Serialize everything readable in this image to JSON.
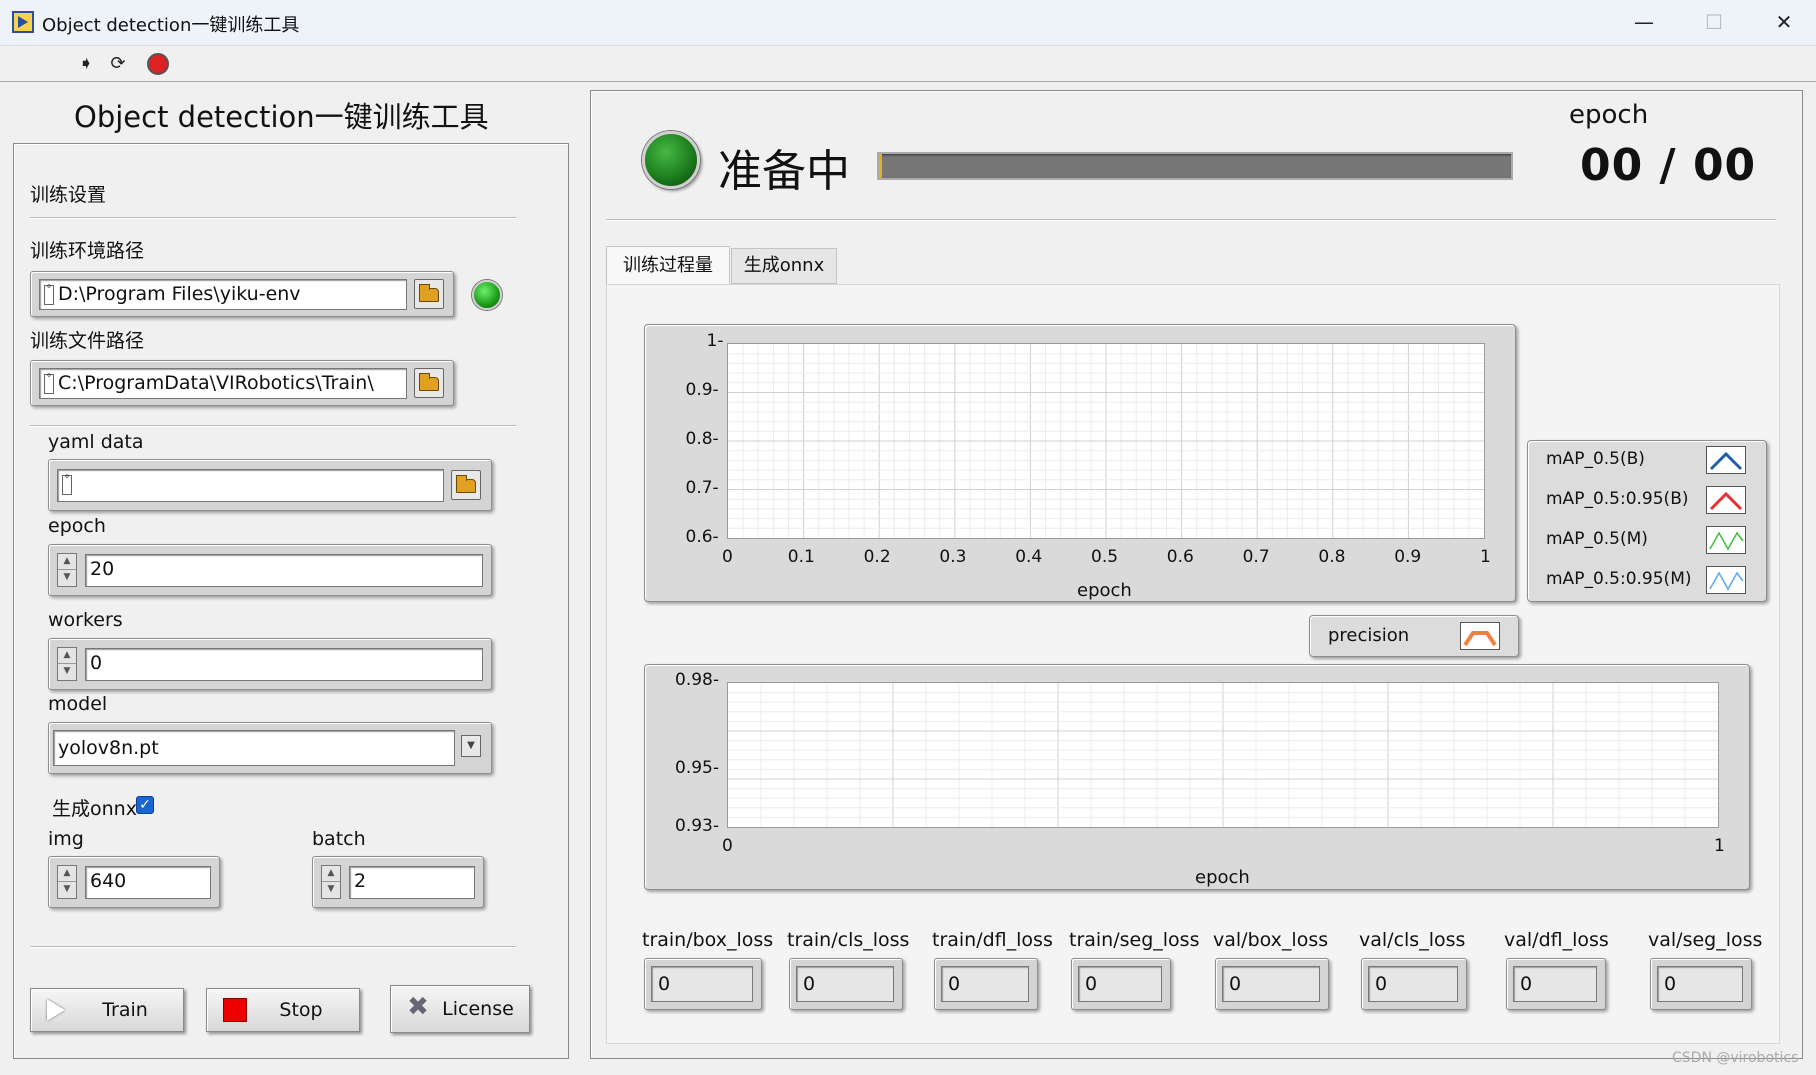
{
  "window": {
    "title": "Object detection一键训练工具",
    "minimize": "—",
    "maximize": "☐",
    "close": "✕"
  },
  "toolbar": {
    "run_icon": "run-arrow-icon",
    "run_continuous_icon": "run-continuously-icon",
    "abort_icon": "abort-icon"
  },
  "heading": "Object detection一键训练工具",
  "settings": {
    "section_title": "训练设置",
    "env_path": {
      "label": "训练环境路径",
      "value": "D:\\Program Files\\yiku-env",
      "status_color": "#22aa22"
    },
    "file_path": {
      "label": "训练文件路径",
      "value": "C:\\ProgramData\\VIRobotics\\Train\\"
    },
    "yaml": {
      "label": "yaml data",
      "value": ""
    },
    "epoch": {
      "label": "epoch",
      "value": "20"
    },
    "workers": {
      "label": "workers",
      "value": "0"
    },
    "model": {
      "label": "model",
      "value": "yolov8n.pt"
    },
    "onnx": {
      "label": "生成onnx",
      "checked": true
    },
    "img": {
      "label": "img",
      "value": "640"
    },
    "batch": {
      "label": "batch",
      "value": "2"
    }
  },
  "buttons": {
    "train": "Train",
    "stop": "Stop",
    "license": "License"
  },
  "status": {
    "text": "准备中",
    "led_color": "#1d7f1d",
    "progress": 0.0,
    "epoch_label": "epoch",
    "epoch_value": "00 / 00"
  },
  "tabs": [
    {
      "label": "训练过程量",
      "active": true
    },
    {
      "label": "生成onnx",
      "active": false
    }
  ],
  "chart_data": [
    {
      "type": "line",
      "xlabel": "epoch",
      "xlim": [
        0,
        1
      ],
      "ylim": [
        0.6,
        1
      ],
      "x_ticks": [
        "0",
        "0.1",
        "0.2",
        "0.3",
        "0.4",
        "0.5",
        "0.6",
        "0.7",
        "0.8",
        "0.9",
        "1"
      ],
      "y_ticks": [
        "1",
        "0.9",
        "0.8",
        "0.7",
        "0.6"
      ],
      "grid": true,
      "legend_position": "right",
      "series": [
        {
          "name": "mAP_0.5(B)",
          "color": "#1f5fa8",
          "values": []
        },
        {
          "name": "mAP_0.5:0.95(B)",
          "color": "#e83030",
          "values": []
        },
        {
          "name": "mAP_0.5(M)",
          "color": "#3cc03c",
          "values": []
        },
        {
          "name": "mAP_0.5:0.95(M)",
          "color": "#55aaee",
          "values": []
        }
      ]
    },
    {
      "type": "line",
      "xlabel": "epoch",
      "xlim": [
        0,
        1
      ],
      "ylim": [
        0.93,
        0.98
      ],
      "x_ticks": [
        "0",
        "1"
      ],
      "y_ticks": [
        "0.98",
        "0.95",
        "0.93"
      ],
      "grid": true,
      "legend_position": "top-right",
      "series": [
        {
          "name": "precision",
          "color": "#f08040",
          "values": []
        }
      ]
    }
  ],
  "losses": [
    {
      "label": "train/box_loss",
      "value": "0"
    },
    {
      "label": "train/cls_loss",
      "value": "0"
    },
    {
      "label": "train/dfl_loss",
      "value": "0"
    },
    {
      "label": "train/seg_loss",
      "value": "0"
    },
    {
      "label": "val/box_loss",
      "value": "0"
    },
    {
      "label": "val/cls_loss",
      "value": "0"
    },
    {
      "label": "val/dfl_loss",
      "value": "0"
    },
    {
      "label": "val/seg_loss",
      "value": "0"
    }
  ],
  "watermark": "CSDN @virobotics"
}
